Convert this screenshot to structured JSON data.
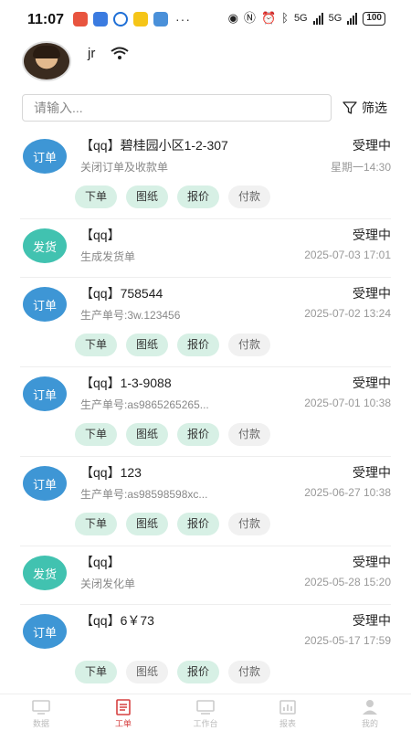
{
  "status_bar": {
    "time": "11:07",
    "dots": "···",
    "net1": "5G",
    "net2": "5G",
    "battery": "100"
  },
  "header": {
    "username": "jr"
  },
  "search": {
    "placeholder": "请输入..."
  },
  "filter": {
    "label": "筛选"
  },
  "orders": [
    {
      "badge": "订单",
      "badge_color": "#3e96d5",
      "title": "【qq】碧桂园小区1-2-307",
      "status": "受理中",
      "subtitle": "关闭订单及收款单",
      "date": "星期一14:30",
      "tags": [
        "下单",
        "图纸",
        "报价",
        "付款"
      ]
    },
    {
      "badge": "发货",
      "badge_color": "#41c2b0",
      "title": "【qq】",
      "status": "受理中",
      "subtitle": "生成发货单",
      "date": "2025-07-03 17:01",
      "tags": []
    },
    {
      "badge": "订单",
      "badge_color": "#3e96d5",
      "title": "【qq】758544",
      "status": "受理中",
      "subtitle": "生产单号:3w.123456",
      "date": "2025-07-02 13:24",
      "tags": [
        "下单",
        "图纸",
        "报价",
        "付款"
      ]
    },
    {
      "badge": "订单",
      "badge_color": "#3e96d5",
      "title": "【qq】1-3-9088",
      "status": "受理中",
      "subtitle": "生产单号:as9865265265...",
      "date": "2025-07-01 10:38",
      "tags": [
        "下单",
        "图纸",
        "报价",
        "付款"
      ]
    },
    {
      "badge": "订单",
      "badge_color": "#3e96d5",
      "title": "【qq】123",
      "status": "受理中",
      "subtitle": "生产单号:as98598598xc...",
      "date": "2025-06-27 10:38",
      "tags": [
        "下单",
        "图纸",
        "报价",
        "付款"
      ]
    },
    {
      "badge": "发货",
      "badge_color": "#41c2b0",
      "title": "【qq】",
      "status": "受理中",
      "subtitle": "关闭发化单",
      "date": "2025-05-28 15:20",
      "tags": []
    },
    {
      "badge": "订单",
      "badge_color": "#3e96d5",
      "title": "【qq】6￥73",
      "status": "受理中",
      "subtitle": "",
      "date": "2025-05-17 17:59",
      "tags": [
        "下单",
        "图纸",
        "报价",
        "付款"
      ]
    }
  ],
  "tabs": [
    {
      "label": "数据",
      "icon": "monitor-icon"
    },
    {
      "label": "工单",
      "icon": "document-icon"
    },
    {
      "label": "工作台",
      "icon": "workbench-icon"
    },
    {
      "label": "报表",
      "icon": "chart-icon"
    },
    {
      "label": "我的",
      "icon": "person-icon"
    }
  ],
  "colors": {
    "accent_red": "#d64040",
    "badge_blue": "#3e96d5",
    "badge_teal": "#41c2b0",
    "tag_green": "#d7f0e5"
  }
}
